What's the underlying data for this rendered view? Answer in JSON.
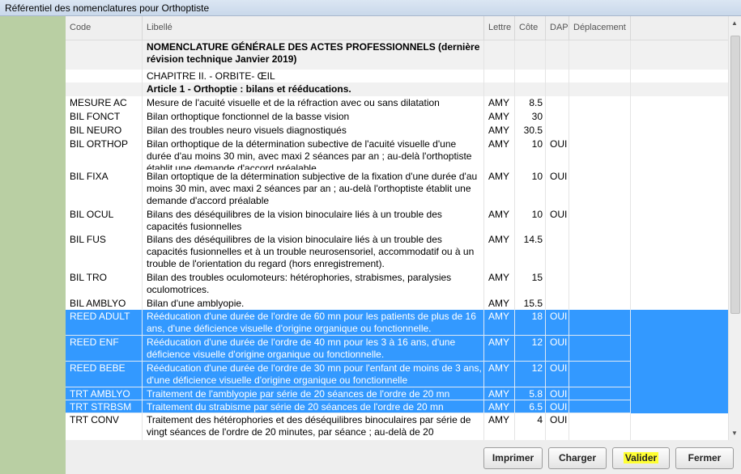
{
  "window": {
    "title": "Référentiel des nomenclatures pour Orthoptiste"
  },
  "columns": {
    "code": "Code",
    "libelle": "Libellé",
    "lettre": "Lettre",
    "cote": "Côte",
    "dap": "DAP",
    "deplacement": "Déplacement"
  },
  "rows": [
    {
      "kind": "section",
      "code": "",
      "libelle": "NOMENCLATURE GÉNÉRALE DES ACTES PROFESSIONNELS (dernière révision technique Janvier 2019)",
      "lettre": "",
      "cote": "",
      "dap": ""
    },
    {
      "kind": "plain",
      "code": "",
      "libelle": "CHAPITRE II. - ORBITE- ŒIL",
      "lettre": "",
      "cote": "",
      "dap": ""
    },
    {
      "kind": "section",
      "code": "",
      "libelle": "Article 1 - Orthoptie : bilans et rééducations.",
      "lettre": "",
      "cote": "",
      "dap": ""
    },
    {
      "kind": "plain",
      "code": "MESURE AC",
      "libelle": "Mesure de l'acuité visuelle et de la réfraction avec ou sans dilatation",
      "lettre": "AMY",
      "cote": "8.5",
      "dap": ""
    },
    {
      "kind": "plain",
      "code": "BIL FONCT",
      "libelle": "Bilan orthoptique fonctionnel de la basse vision",
      "lettre": "AMY",
      "cote": "30",
      "dap": ""
    },
    {
      "kind": "plain",
      "code": "BIL NEURO",
      "libelle": "Bilan des troubles neuro visuels diagnostiqués",
      "lettre": "AMY",
      "cote": "30.5",
      "dap": ""
    },
    {
      "kind": "plain",
      "code": "BIL ORTHOP",
      "libelle": "Bilan orthoptique de la détermination subective de l'acuité visuelle d'une durée d'au moins 30 min, avec maxi 2 séances par an ; au-delà l'orthoptiste établit une demande d'accord préalable",
      "lettre": "AMY",
      "cote": "10",
      "dap": "OUI"
    },
    {
      "kind": "plain",
      "code": "BIL FIXA",
      "libelle": "Bilan ortoptique de la détermination subjective de la fixation d'une durée d'au moins 30 min, avec maxi 2 séances par an ; au-delà l'orthoptiste établit une demande d'accord préalable",
      "lettre": "AMY",
      "cote": "10",
      "dap": "OUI"
    },
    {
      "kind": "plain",
      "code": "BIL OCUL",
      "libelle": "Bilans des déséquilibres de la vision binoculaire liés à un trouble des capacités fusionnelles",
      "lettre": "AMY",
      "cote": "10",
      "dap": "OUI"
    },
    {
      "kind": "plain",
      "code": "BIL FUS",
      "libelle": "Bilans des déséquilibres de la vision binoculaire liés à un trouble des capacités fusionnelles et à un trouble neurosensoriel, accommodatif ou à un trouble de l'orientation du regard (hors enregistrement).",
      "lettre": "AMY",
      "cote": "14.5",
      "dap": ""
    },
    {
      "kind": "plain",
      "code": "BIL TRO",
      "libelle": "Bilan des troubles oculomoteurs: hétérophories, strabismes, paralysies oculomotrices.",
      "lettre": "AMY",
      "cote": "15",
      "dap": ""
    },
    {
      "kind": "plain",
      "code": "BIL AMBLYO",
      "libelle": "Bilan d'une amblyopie.",
      "lettre": "AMY",
      "cote": "15.5",
      "dap": ""
    },
    {
      "kind": "selected",
      "code": "REED ADULT",
      "libelle": "Rééducation d'une durée de l'ordre de 60 mn pour les patients de plus de 16 ans, d'une déficience visuelle d'origine organique ou fonctionnelle.",
      "lettre": "AMY",
      "cote": "18",
      "dap": "OUI"
    },
    {
      "kind": "selected",
      "code": "REED ENF",
      "libelle": "Rééducation d'une durée de l'ordre de 40 mn pour les 3 à 16 ans, d'une déficience visuelle d'origine organique ou fonctionnelle.",
      "lettre": "AMY",
      "cote": "12",
      "dap": "OUI"
    },
    {
      "kind": "selected",
      "code": "REED BEBE",
      "libelle": "Rééducation d'une durée de l'ordre de 30 mn pour l'enfant de moins de 3 ans, d'une déficience visuelle d'origine organique ou fonctionnelle",
      "lettre": "AMY",
      "cote": "12",
      "dap": "OUI"
    },
    {
      "kind": "selected",
      "code": "TRT AMBLYO",
      "libelle": "Traitement de l'amblyopie par série de 20 séances de l'ordre de 20 mn",
      "lettre": "AMY",
      "cote": "5.8",
      "dap": "OUI"
    },
    {
      "kind": "selected",
      "code": "TRT STRBSM",
      "libelle": "Traitement du strabisme par série de 20 séances de l'ordre de 20 mn",
      "lettre": "AMY",
      "cote": "6.5",
      "dap": "OUI"
    },
    {
      "kind": "plain",
      "code": "TRT CONV",
      "libelle": "Traitement des hétérophories et des déséquilibres binoculaires par série de vingt séances de l'ordre de 20 minutes, par séance ; au-delà de 20",
      "lettre": "AMY",
      "cote": "4",
      "dap": "OUI"
    }
  ],
  "buttons": {
    "imprimer": "Imprimer",
    "charger": "Charger",
    "valider": "Valider",
    "fermer": "Fermer"
  },
  "colors": {
    "selection": "#3399ff",
    "side_panel": "#b9cfa3",
    "highlight": "#ffff33"
  },
  "icons": {
    "scroll_up": "scroll-up-arrow-icon",
    "scroll_down": "scroll-down-arrow-icon"
  }
}
